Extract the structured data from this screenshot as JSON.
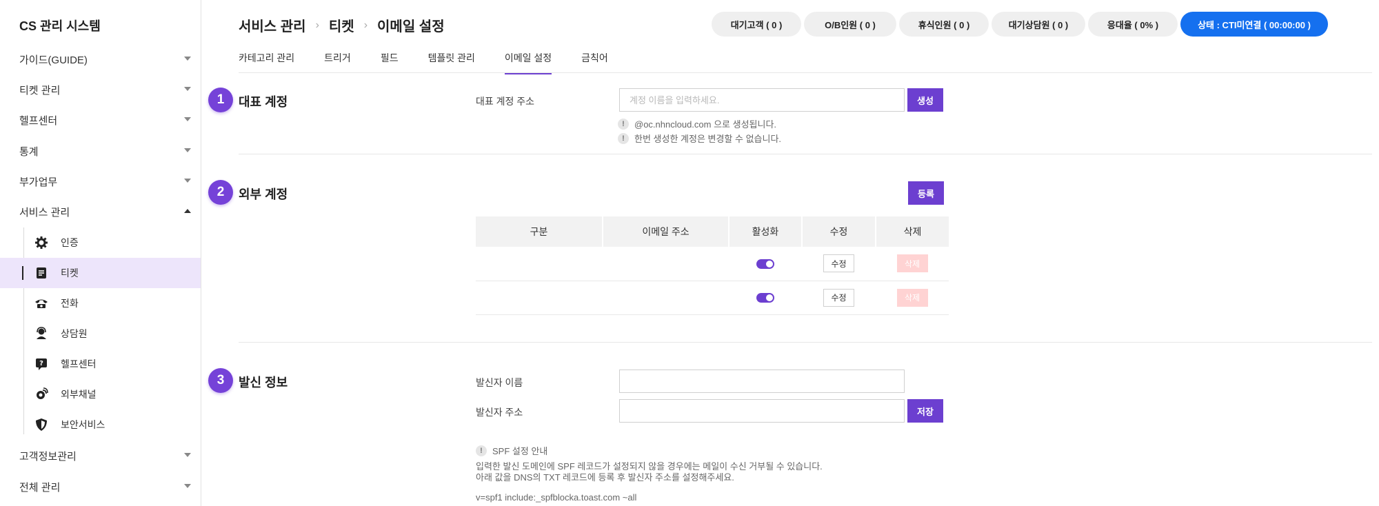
{
  "sidebar": {
    "brand": "CS 관리 시스템",
    "menu": [
      {
        "label": "가이드(GUIDE)"
      },
      {
        "label": "티켓 관리"
      },
      {
        "label": "헬프센터"
      },
      {
        "label": "통계"
      },
      {
        "label": "부가업무"
      },
      {
        "label": "서비스 관리"
      }
    ],
    "submenu": [
      {
        "label": "인증",
        "icon": "gear-icon"
      },
      {
        "label": "티켓",
        "icon": "document-icon"
      },
      {
        "label": "전화",
        "icon": "phone-icon"
      },
      {
        "label": "상담원",
        "icon": "agent-icon"
      },
      {
        "label": "헬프센터",
        "icon": "help-icon"
      },
      {
        "label": "외부채널",
        "icon": "channel-icon"
      },
      {
        "label": "보안서비스",
        "icon": "shield-icon"
      }
    ],
    "menu_bottom": [
      {
        "label": "고객정보관리"
      },
      {
        "label": "전체 관리"
      }
    ]
  },
  "header": {
    "breadcrumb": [
      "서비스 관리",
      "티켓",
      "이메일 설정"
    ],
    "pills": [
      {
        "label": "대기고객 ( 0 )"
      },
      {
        "label": "O/B인원 ( 0 )"
      },
      {
        "label": "휴식인원 ( 0 )"
      },
      {
        "label": "대기상담원 ( 0 )"
      },
      {
        "label": "응대율 ( 0% )"
      },
      {
        "label": "상태 : CTI미연결 ( 00:00:00 )"
      }
    ]
  },
  "tabs": [
    {
      "label": "카테고리 관리"
    },
    {
      "label": "트리거"
    },
    {
      "label": "필드"
    },
    {
      "label": "템플릿 관리"
    },
    {
      "label": "이메일 설정"
    },
    {
      "label": "금칙어"
    }
  ],
  "section1": {
    "number": "1",
    "title": "대표 계정",
    "field_label": "대표 계정 주소",
    "placeholder": "계정 이름을 입력하세요.",
    "button": "생성",
    "notes": [
      "@oc.nhncloud.com 으로 생성됩니다.",
      "한번 생성한 계정은 변경할 수 없습니다."
    ]
  },
  "section2": {
    "number": "2",
    "title": "외부 계정",
    "button": "등록",
    "columns": [
      "구분",
      "이메일 주소",
      "활성화",
      "수정",
      "삭제"
    ],
    "rows": [
      {
        "type": "",
        "email": "",
        "enabled": true,
        "edit": "수정",
        "delete": "삭제"
      },
      {
        "type": "",
        "email": "",
        "enabled": true,
        "edit": "수정",
        "delete": "삭제"
      }
    ]
  },
  "section3": {
    "number": "3",
    "title": "발신 정보",
    "sender_name_label": "발신자 이름",
    "sender_address_label": "발신자 주소",
    "save_button": "저장",
    "spf_title": "SPF 설정 안내",
    "spf_line1": "입력한 발신 도메인에 SPF 레코드가 설정되지 않을 경우에는 메일이 수신 거부될 수 있습니다.",
    "spf_line2": "아래 값을 DNS의 TXT 레코드에 등록 후 발신자 주소를 설정해주세요.",
    "spf_value": "v=spf1 include:_spfblocka.toast.com ~all"
  },
  "colors": {
    "accent": "#6c3fd0",
    "status": "#1570ef",
    "active_bg": "#ede5fb"
  }
}
